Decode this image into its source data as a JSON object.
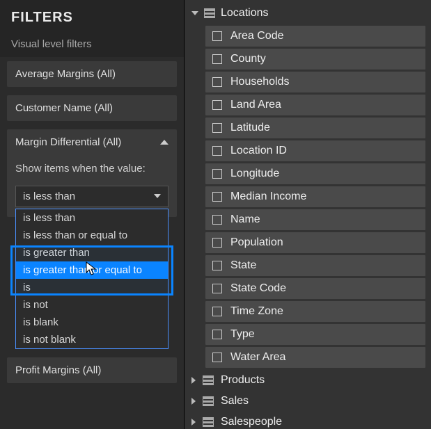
{
  "filters": {
    "title": "FILTERS",
    "subtitle": "Visual level filters",
    "cards": [
      {
        "label": "Average Margins  (All)"
      },
      {
        "label": "Customer Name  (All)"
      }
    ],
    "expanded": {
      "label": "Margin Differential  (All)",
      "instruction": "Show items when the value:",
      "selected": "is less than",
      "options": [
        "is less than",
        "is less than or equal to",
        "is greater than",
        "is greater than or equal to",
        "is",
        "is not",
        "is blank",
        "is not blank"
      ],
      "hovered_index": 3
    },
    "last_card": {
      "label": "Profit Margins  (All)"
    }
  },
  "fields": {
    "expanded_table": "Locations",
    "columns": [
      "Area Code",
      "County",
      "Households",
      "Land Area",
      "Latitude",
      "Location ID",
      "Longitude",
      "Median Income",
      "Name",
      "Population",
      "State",
      "State Code",
      "Time Zone",
      "Type",
      "Water Area"
    ],
    "collapsed_tables": [
      "Products",
      "Sales",
      "Salespeople"
    ]
  }
}
